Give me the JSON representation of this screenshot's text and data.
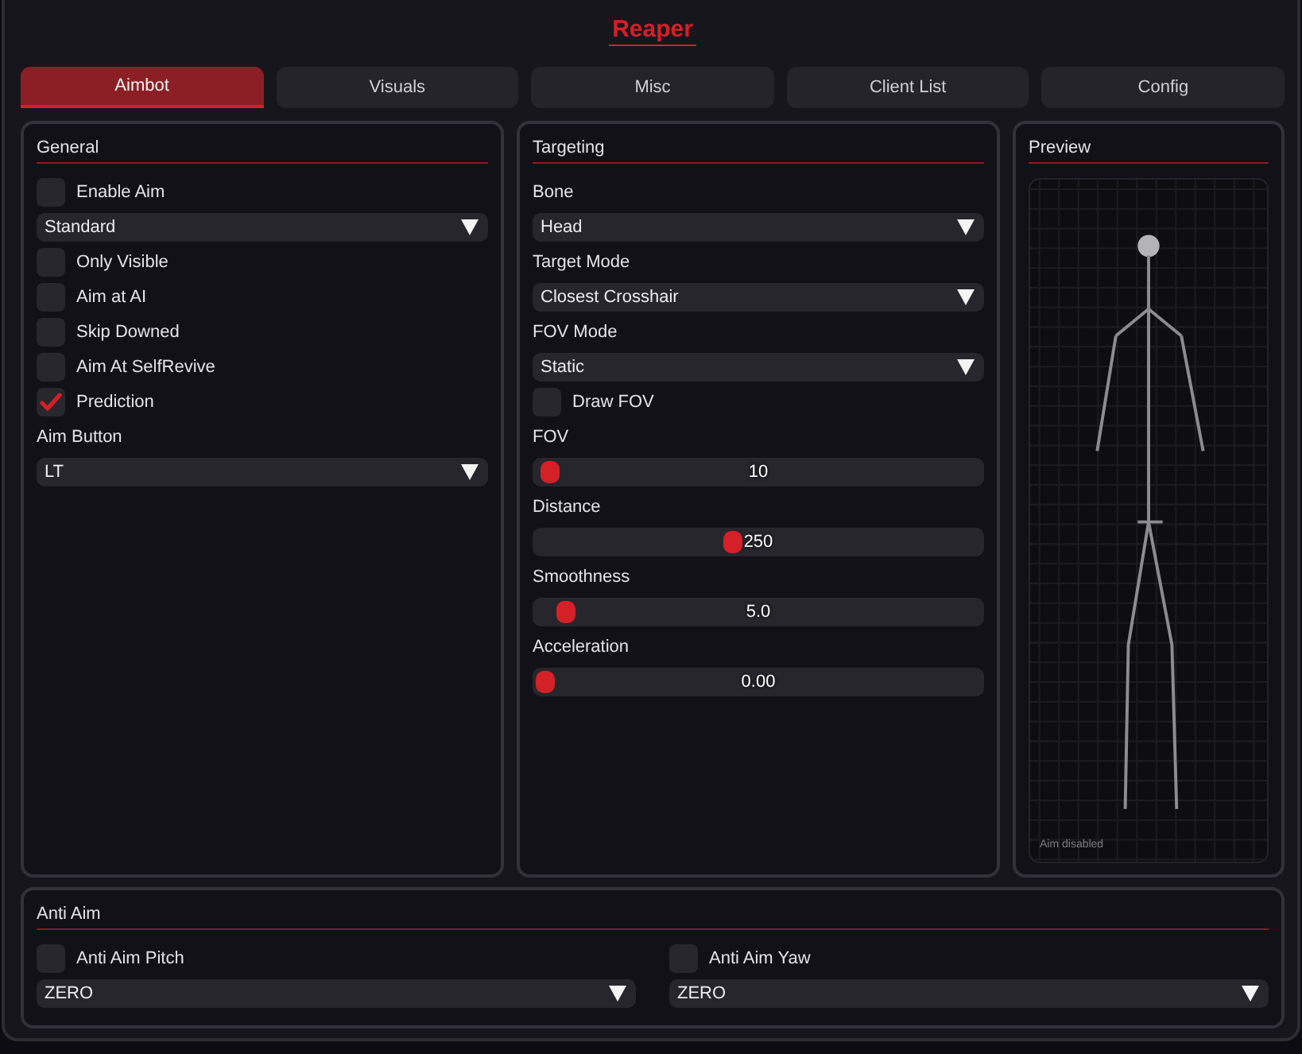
{
  "window": {
    "title": "Reaper"
  },
  "tabs": [
    {
      "label": "Aimbot",
      "selected": true
    },
    {
      "label": "Visuals",
      "selected": false
    },
    {
      "label": "Misc",
      "selected": false
    },
    {
      "label": "Client List",
      "selected": false
    },
    {
      "label": "Config",
      "selected": false
    }
  ],
  "general": {
    "title": "General",
    "items": [
      {
        "kind": "checkbox",
        "label": "Enable Aim",
        "checked": false
      },
      {
        "kind": "dropdown",
        "value": "Standard"
      },
      {
        "kind": "checkbox",
        "label": "Only Visible",
        "checked": false
      },
      {
        "kind": "checkbox",
        "label": "Aim at AI",
        "checked": false
      },
      {
        "kind": "checkbox",
        "label": "Skip Downed",
        "checked": false
      },
      {
        "kind": "checkbox",
        "label": "Aim At SelfRevive",
        "checked": false
      },
      {
        "kind": "checkbox",
        "label": "Prediction",
        "checked": true
      },
      {
        "kind": "label",
        "text": "Aim Button"
      },
      {
        "kind": "dropdown",
        "value": "LT"
      }
    ]
  },
  "targeting": {
    "title": "Targeting",
    "items": [
      {
        "kind": "label",
        "text": "Bone"
      },
      {
        "kind": "dropdown",
        "value": "Head"
      },
      {
        "kind": "label",
        "text": "Target Mode"
      },
      {
        "kind": "dropdown",
        "value": "Closest Crosshair"
      },
      {
        "kind": "label",
        "text": "FOV Mode"
      },
      {
        "kind": "dropdown",
        "value": "Static"
      },
      {
        "kind": "checkbox",
        "label": "Draw FOV",
        "checked": false
      },
      {
        "kind": "label",
        "text": "FOV"
      },
      {
        "kind": "slider",
        "value": "10",
        "level": 0.01
      },
      {
        "kind": "label",
        "text": "Distance"
      },
      {
        "kind": "slider",
        "value": "250",
        "level": 0.44
      },
      {
        "kind": "label",
        "text": "Smoothness"
      },
      {
        "kind": "slider",
        "value": "5.0",
        "level": 0.05
      },
      {
        "kind": "label",
        "text": "Acceleration"
      },
      {
        "kind": "slider",
        "value": "0.00",
        "level": 0.0
      }
    ]
  },
  "preview": {
    "title": "Preview",
    "status": "Aim disabled"
  },
  "anti_aim": {
    "title": "Anti Aim",
    "columns": [
      {
        "checkbox": {
          "label": "Anti Aim Pitch",
          "checked": false
        },
        "dropdown": {
          "value": "ZERO"
        }
      },
      {
        "checkbox": {
          "label": "Anti Aim Yaw",
          "checked": false
        },
        "dropdown": {
          "value": "ZERO"
        }
      }
    ]
  }
}
